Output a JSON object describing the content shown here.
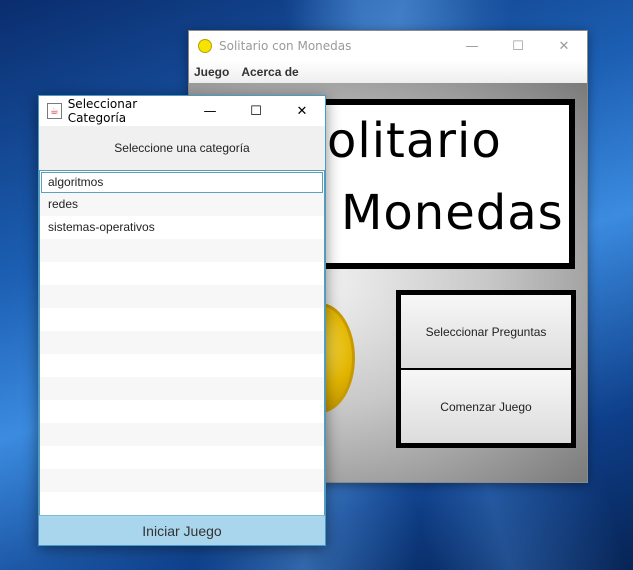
{
  "main_window": {
    "title": "Solitario con Monedas",
    "menu": [
      "Juego",
      "Acerca de"
    ],
    "board_line1": "olitario",
    "board_line2": "Monedas",
    "select_questions_label": "Seleccionar Preguntas",
    "start_game_label": "Comenzar Juego",
    "controls": {
      "minimize": "—",
      "maximize": "☐",
      "close": "✕"
    }
  },
  "dialog": {
    "title": "Seleccionar Categoría",
    "heading": "Seleccione una categoría",
    "categories": [
      "algoritmos",
      "redes",
      "sistemas-operativos"
    ],
    "selected_index": 0,
    "start_button_label": "Iniciar Juego",
    "controls": {
      "minimize": "—",
      "maximize": "☐",
      "close": "✕"
    }
  },
  "colors": {
    "accent": "#a9d6ec",
    "coin": "#f5e400",
    "list_border": "#5a9db8"
  }
}
